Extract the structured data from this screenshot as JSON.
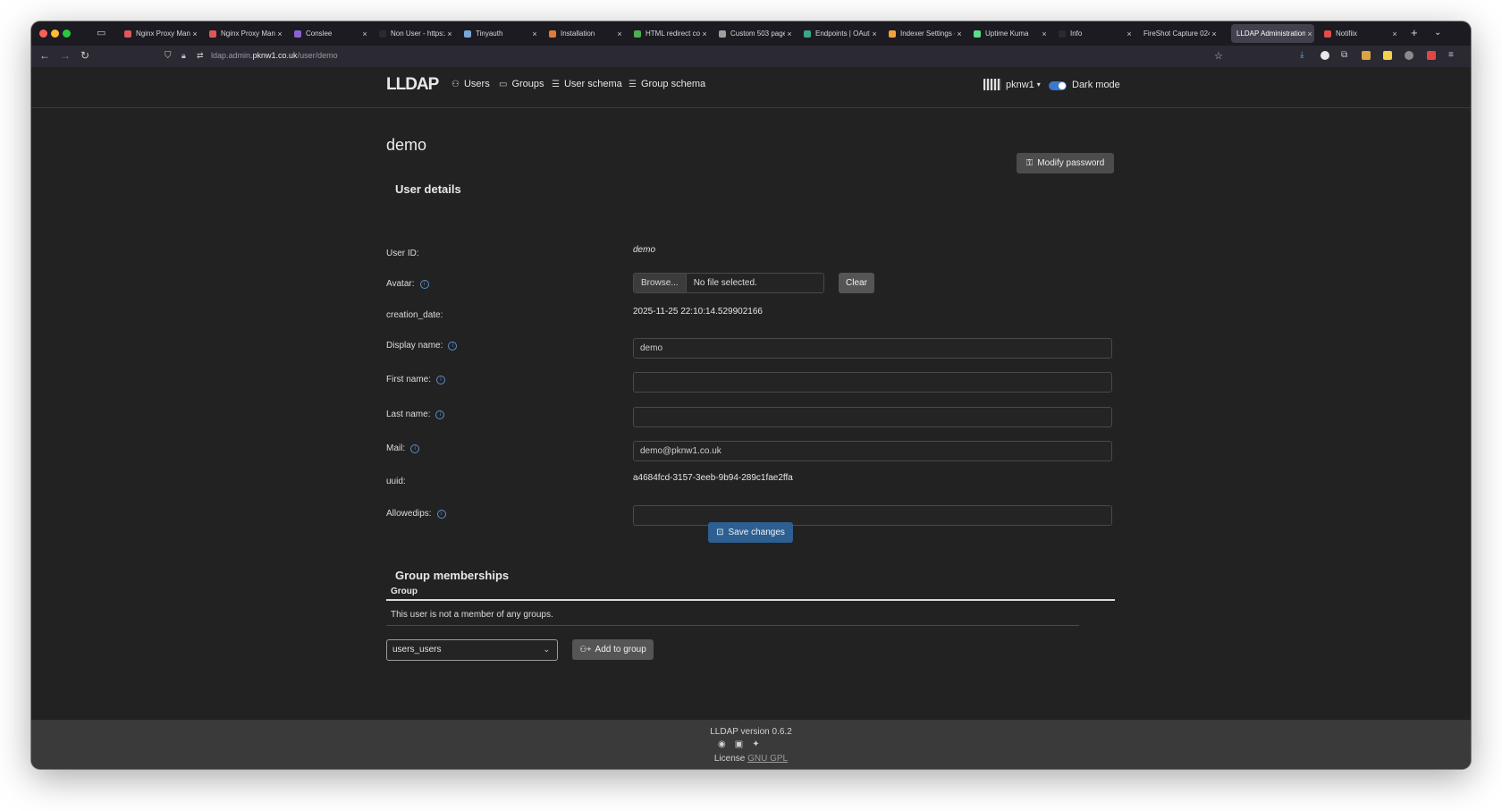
{
  "browser": {
    "tabs": [
      {
        "title": "Nginx Proxy Mana",
        "color": "#e15759"
      },
      {
        "title": "Nginx Proxy Mana",
        "color": "#e15759"
      },
      {
        "title": "Conslee",
        "color": "#8a63d2"
      },
      {
        "title": "Non User - https://wa",
        "color": "#777777"
      },
      {
        "title": "Tinyauth",
        "color": "#7aa6d8"
      },
      {
        "title": "Installation",
        "color": "#e07b39"
      },
      {
        "title": "HTML redirect co",
        "color": "#4caf50"
      },
      {
        "title": "Custom 503 page",
        "color": "#9e9e9e"
      },
      {
        "title": "Endpoints | OAuth",
        "color": "#3aa78a"
      },
      {
        "title": "Indexer Settings -",
        "color": "#f4a23b"
      },
      {
        "title": "Uptime Kuma",
        "color": "#5cdd8b"
      },
      {
        "title": "Info",
        "color": "#2b2a33"
      },
      {
        "title": "FireShot Capture 024",
        "color": "#2b2a33"
      },
      {
        "title": "LLDAP Administration",
        "color": "#42414d"
      },
      {
        "title": "Notifiix",
        "color": "#e34b4b"
      }
    ],
    "active_tab_index": 13,
    "url_prefix": "ldap.admin.",
    "url_domain": "pknw1.co.uk",
    "url_path": "/user/demo"
  },
  "app": {
    "logo": "LLDAP",
    "nav": {
      "users": "Users",
      "groups": "Groups",
      "user_schema": "User schema",
      "group_schema": "Group schema"
    },
    "current_user": "pknw1",
    "dark_mode_label": "Dark mode",
    "dark_mode_on": true
  },
  "page": {
    "title": "demo",
    "modify_password": "Modify password",
    "user_details_heading": "User details",
    "fields": {
      "user_id_label": "User ID:",
      "user_id_value": "demo",
      "avatar_label": "Avatar:",
      "browse_label": "Browse...",
      "no_file_label": "No file selected.",
      "clear_label": "Clear",
      "creation_date_label": "creation_date:",
      "creation_date_value": "2025-11-25 22:10:14.529902166",
      "display_name_label": "Display name:",
      "display_name_value": "demo",
      "first_name_label": "First name:",
      "first_name_value": "",
      "last_name_label": "Last name:",
      "last_name_value": "",
      "mail_label": "Mail:",
      "mail_value": "demo@pknw1.co.uk",
      "uuid_label": "uuid:",
      "uuid_value": "a4684fcd-3157-3eeb-9b94-289c1fae2ffa",
      "allowedips_label": "Allowedips:",
      "allowedips_value": ""
    },
    "save_changes": "Save changes",
    "group_memberships_heading": "Group memberships",
    "group_column_header": "Group",
    "no_groups_text": "This user is not a member of any groups.",
    "group_select_value": "users_users",
    "add_to_group": "Add to group"
  },
  "footer": {
    "version": "LLDAP version 0.6.2",
    "license_prefix": "License",
    "license_link": "GNU GPL",
    "icons": [
      "github-icon",
      "discord-icon",
      "twitter-icon"
    ]
  }
}
